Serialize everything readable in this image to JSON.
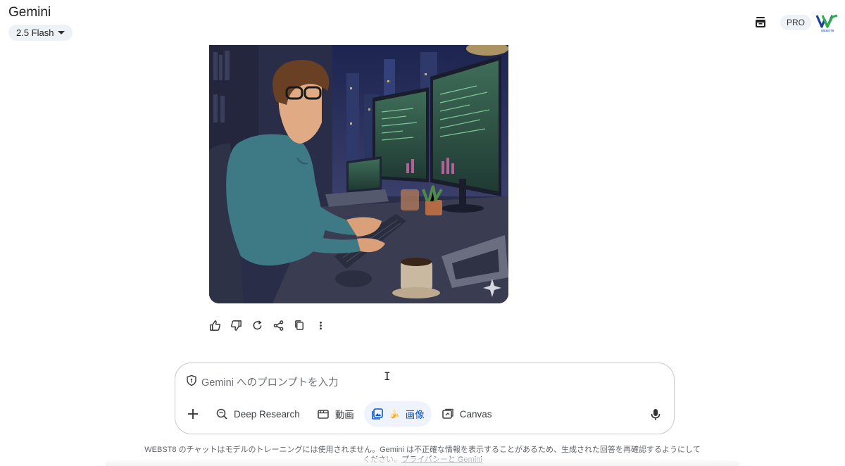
{
  "app": {
    "title": "Gemini",
    "model_label": "2.5 Flash"
  },
  "header": {
    "pro_label": "PRO",
    "history_icon": "archive-icon",
    "account_logo_text": "WEBST8"
  },
  "image": {
    "description_icon": "sparkle-icon"
  },
  "response_actions": [
    {
      "name": "thumbs-up-icon"
    },
    {
      "name": "thumbs-down-icon"
    },
    {
      "name": "regenerate-icon"
    },
    {
      "name": "share-icon"
    },
    {
      "name": "copy-icon"
    },
    {
      "name": "more-vert-icon"
    }
  ],
  "prompt": {
    "placeholder": "Gemini へのプロンプトを入力",
    "tools": [
      {
        "label": "Deep Research",
        "icon": "deep-research-icon"
      },
      {
        "label": "動画",
        "icon": "video-icon"
      },
      {
        "label": "画像",
        "icon": "image-icon",
        "emoji": "🍌",
        "active": true
      },
      {
        "label": "Canvas",
        "icon": "canvas-icon"
      }
    ]
  },
  "footer": {
    "text": "WEBST8 のチャットはモデルのトレーニングには使用されません。Gemini は不正確な情報を表示することがあるため、生成された回答を再確認するようにしてください。",
    "link": "プライバシーと Gemini"
  },
  "colors": {
    "accent": "#0b57d0",
    "pill_bg": "#eef1f6"
  }
}
